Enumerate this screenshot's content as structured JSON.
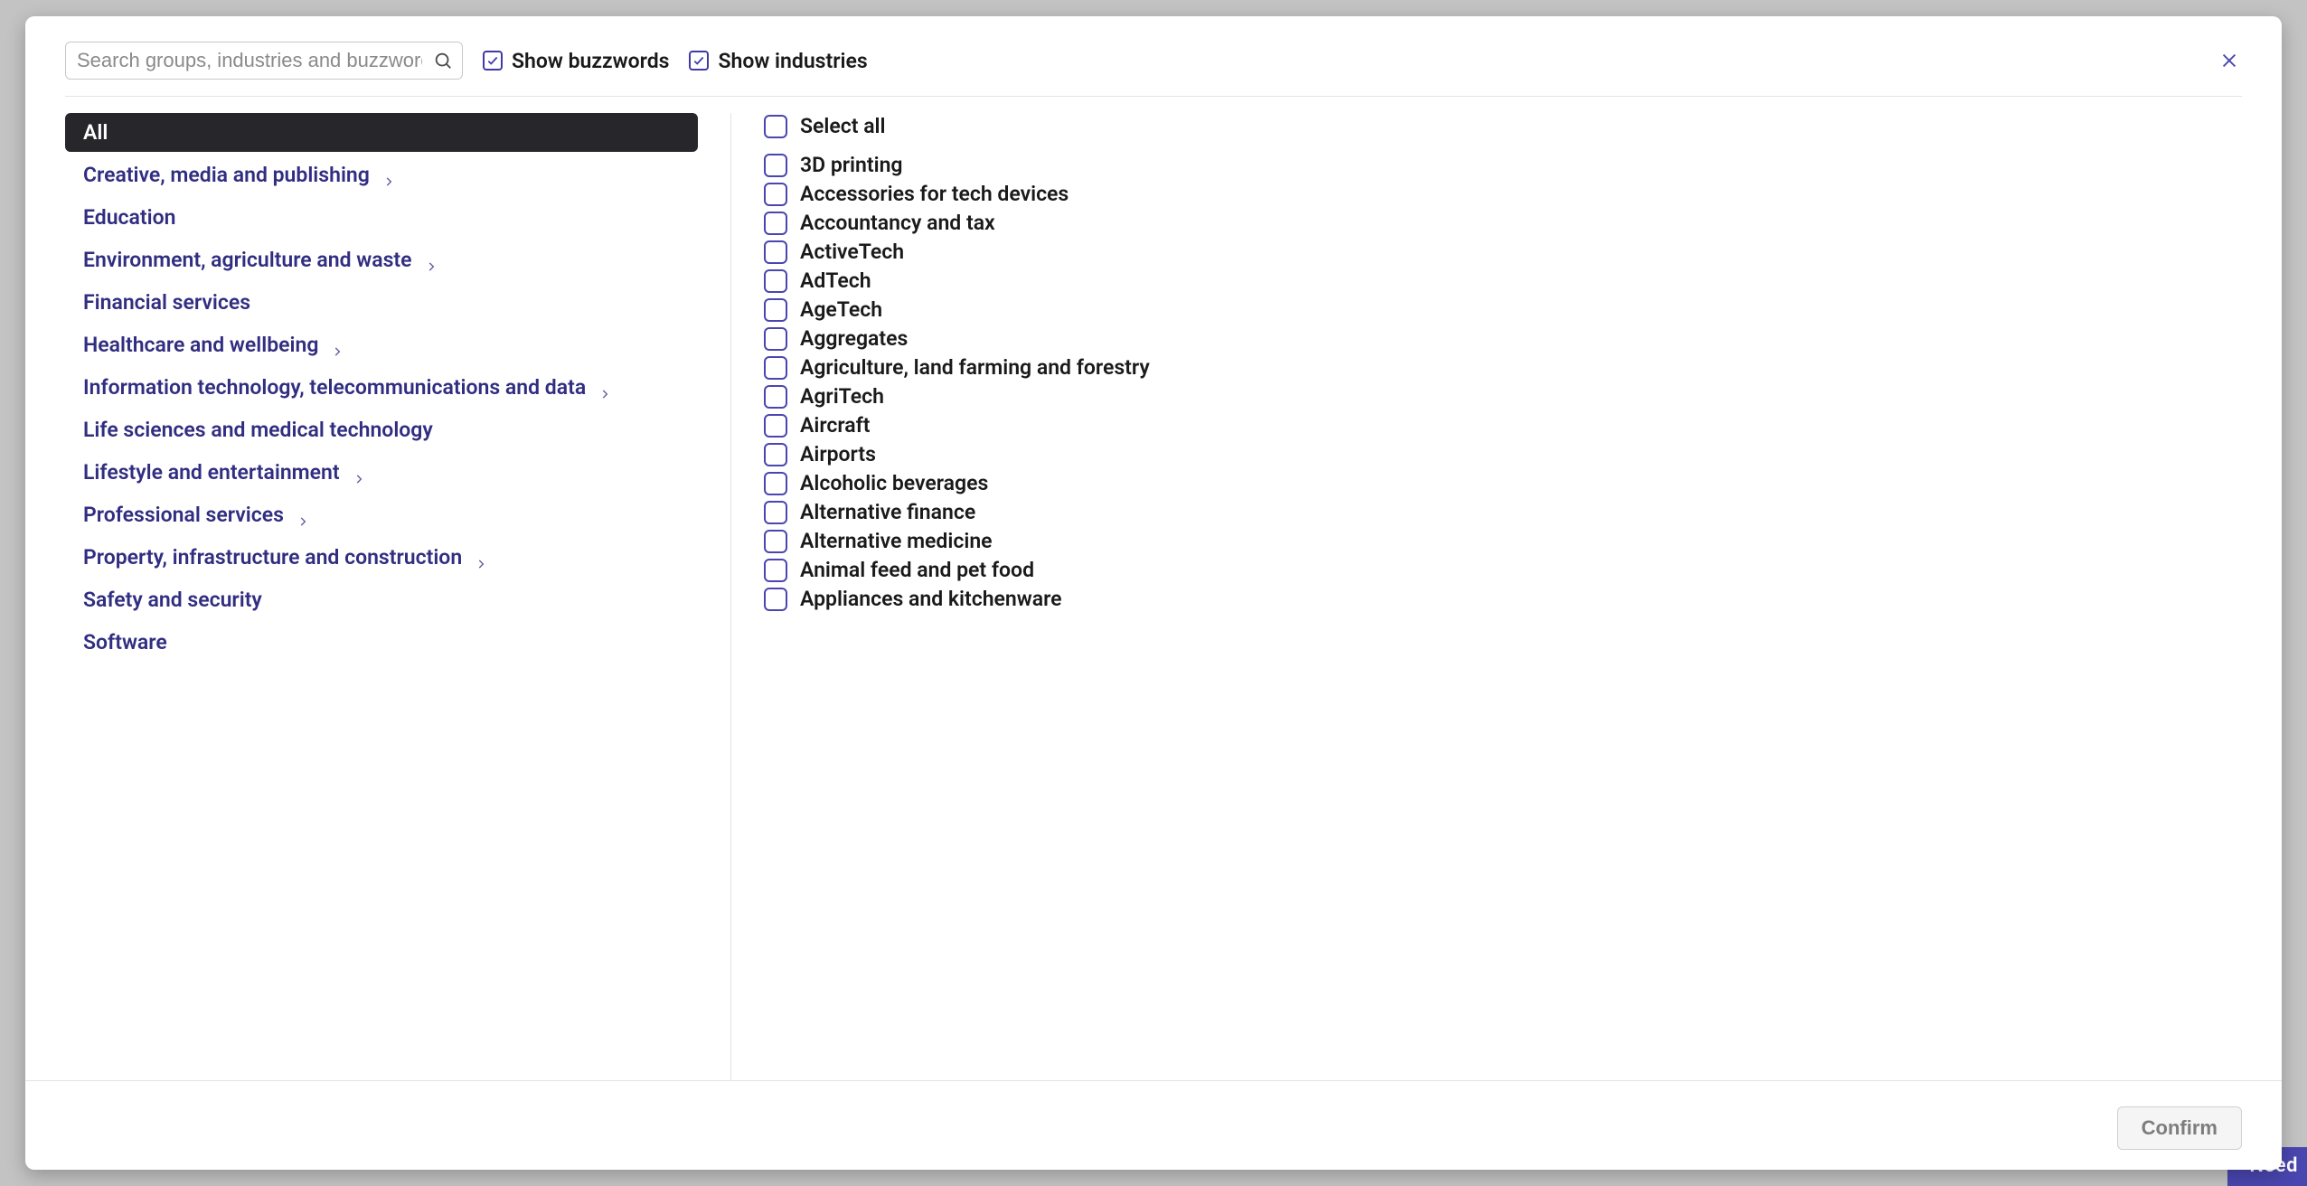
{
  "search": {
    "placeholder": "Search groups, industries and buzzwords",
    "value": ""
  },
  "toggles": {
    "buzzwords": {
      "label": "Show buzzwords",
      "checked": true
    },
    "industries": {
      "label": "Show industries",
      "checked": true
    }
  },
  "categories": [
    {
      "label": "All",
      "selected": true,
      "has_children": false
    },
    {
      "label": "Creative, media and publishing",
      "selected": false,
      "has_children": true
    },
    {
      "label": "Education",
      "selected": false,
      "has_children": false
    },
    {
      "label": "Environment, agriculture and waste",
      "selected": false,
      "has_children": true
    },
    {
      "label": "Financial services",
      "selected": false,
      "has_children": false
    },
    {
      "label": "Healthcare and wellbeing",
      "selected": false,
      "has_children": true
    },
    {
      "label": "Information technology, telecommunications and data",
      "selected": false,
      "has_children": true
    },
    {
      "label": "Life sciences and medical technology",
      "selected": false,
      "has_children": false
    },
    {
      "label": "Lifestyle and entertainment",
      "selected": false,
      "has_children": true
    },
    {
      "label": "Professional services",
      "selected": false,
      "has_children": true
    },
    {
      "label": "Property, infrastructure and construction",
      "selected": false,
      "has_children": true
    },
    {
      "label": "Safety and security",
      "selected": false,
      "has_children": false
    },
    {
      "label": "Software",
      "selected": false,
      "has_children": false
    }
  ],
  "selectAllLabel": "Select all",
  "options": [
    "3D printing",
    "Accessories for tech devices",
    "Accountancy and tax",
    "ActiveTech",
    "AdTech",
    "AgeTech",
    "Aggregates",
    "Agriculture, land farming and forestry",
    "AgriTech",
    "Aircraft",
    "Airports",
    "Alcoholic beverages",
    "Alternative finance",
    "Alternative medicine",
    "Animal feed and pet food",
    "Appliances and kitchenware"
  ],
  "confirmLabel": "Confirm",
  "bgWidgetText": "Need"
}
